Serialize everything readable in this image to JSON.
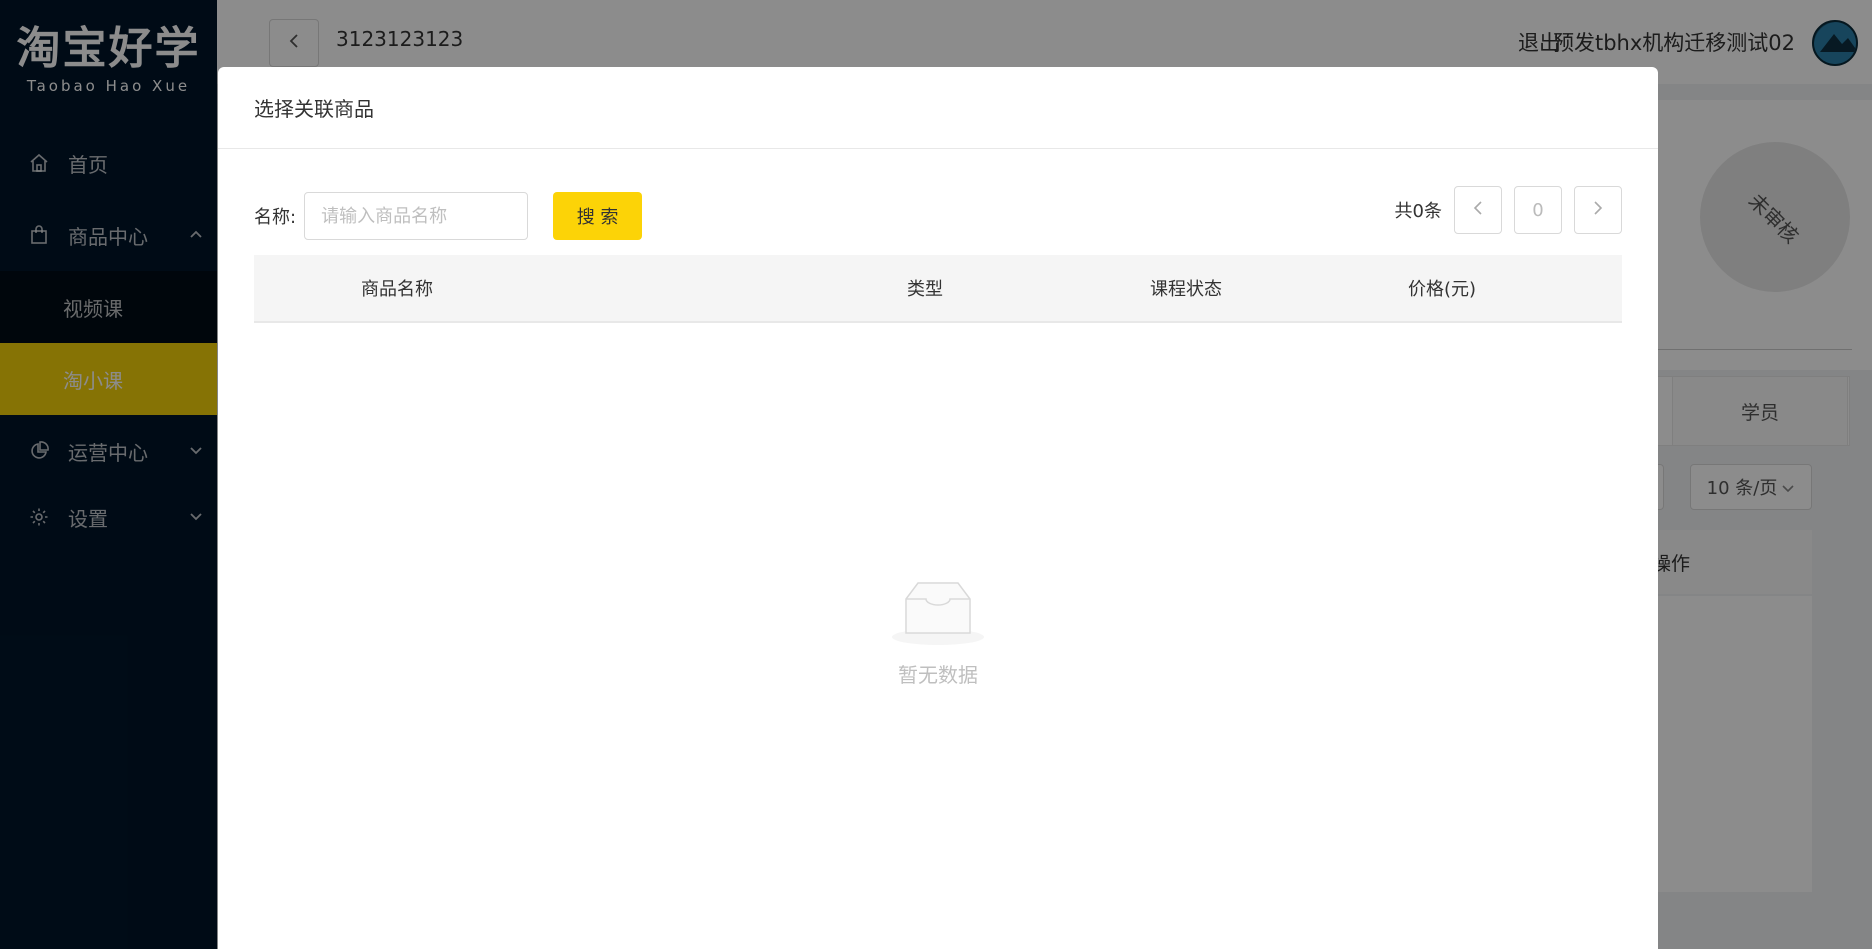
{
  "brand": {
    "name_cn": "淘宝好学",
    "name_en": "Taobao Hao Xue"
  },
  "sidebar": {
    "items": [
      {
        "label": "首页",
        "icon": "home-icon"
      },
      {
        "label": "商品中心",
        "icon": "bag-icon",
        "expanded": true,
        "children": [
          {
            "label": "视频课",
            "active": false
          },
          {
            "label": "淘小课",
            "active": true
          }
        ]
      },
      {
        "label": "运营中心",
        "icon": "pie-chart-icon",
        "expanded": false
      },
      {
        "label": "设置",
        "icon": "gear-icon",
        "expanded": false
      }
    ]
  },
  "header": {
    "title": "3123123123",
    "logout": "退出",
    "account": "预发tbhx机构迁移测试02"
  },
  "background": {
    "badge": "未审核",
    "tab": "学员",
    "page_size": "10 条/页",
    "col_action": "操作"
  },
  "modal": {
    "title": "选择关联商品",
    "search": {
      "label": "名称:",
      "placeholder": "请输入商品名称",
      "value": "",
      "button": "搜 索"
    },
    "pager": {
      "total": "共0条",
      "current": "0"
    },
    "columns": [
      "商品名称",
      "类型",
      "课程状态",
      "价格(元)"
    ],
    "empty_text": "暂无数据"
  },
  "colors": {
    "sidebar_bg": "#001529",
    "accent": "#fcd307",
    "active_menu": "#f5d20a"
  }
}
